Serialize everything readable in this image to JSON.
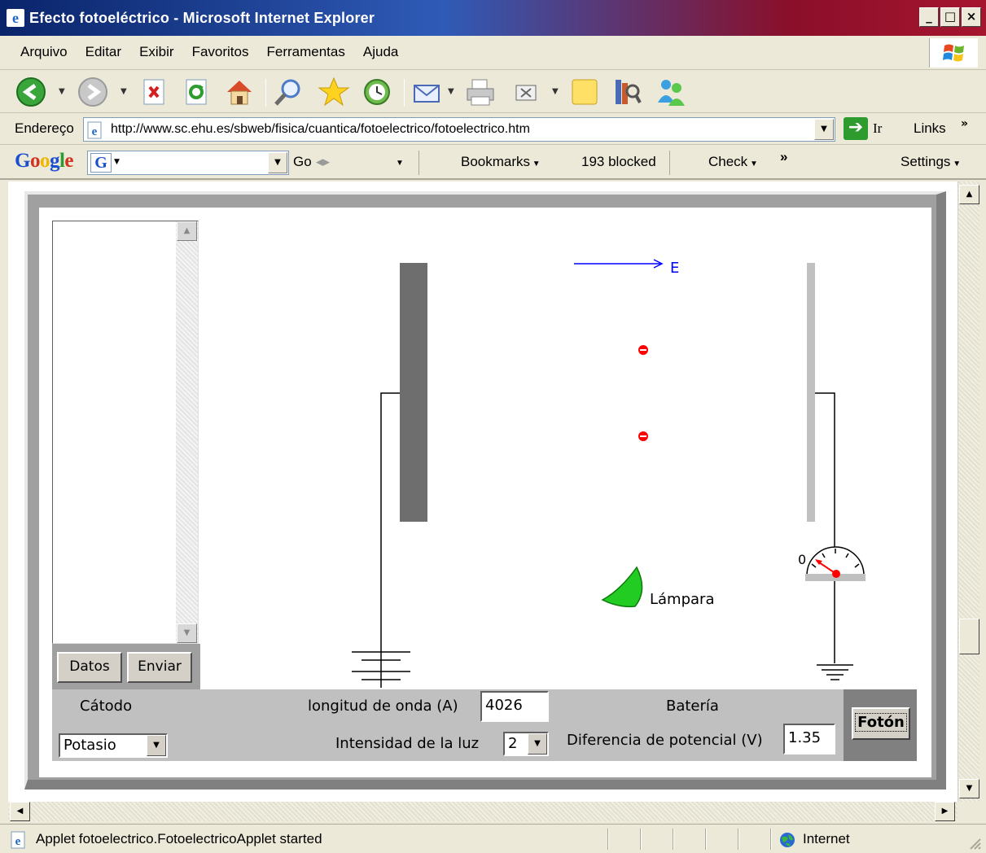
{
  "window": {
    "title": "Efecto fotoeléctrico - Microsoft Internet Explorer",
    "controls": [
      "_",
      "□",
      "×"
    ]
  },
  "menu": [
    "Arquivo",
    "Editar",
    "Exibir",
    "Favoritos",
    "Ferramentas",
    "Ajuda"
  ],
  "address": {
    "label": "Endereço",
    "url": "http://www.sc.ehu.es/sbweb/fisica/cuantica/fotoelectrico/fotoelectrico.htm",
    "go_label": "Ir",
    "links_label": "Links"
  },
  "google_bar": {
    "logo": "Google",
    "go_label": "Go",
    "bookmarks_label": "Bookmarks",
    "blocked_label": "193 blocked",
    "check_label": "Check",
    "settings_label": "Settings"
  },
  "applet": {
    "field_label": "E",
    "lamp_label": "Lámpara",
    "meter_zero": "0",
    "buttons": {
      "datos": "Datos",
      "enviar": "Enviar"
    },
    "cathode": {
      "label": "Cátodo",
      "selected": "Potasio"
    },
    "wavelength": {
      "label": "longitud de onda (A)",
      "value": "4026"
    },
    "intensity": {
      "label": "Intensidad de la luz",
      "selected": "2"
    },
    "battery": {
      "label": "Batería"
    },
    "potential": {
      "label": "Diferencia de potencial (V)",
      "value": "1.35"
    },
    "photon_button": "Fotón"
  },
  "status": {
    "text": "Applet fotoelectrico.FotoelectricoApplet started",
    "zone": "Internet"
  },
  "colors": {
    "field_arrow": "#0000ff",
    "electron": "#ff0000",
    "lamp": "#22cc22",
    "cathode_plate": "#6e6e6e",
    "anode_plate": "#c0c0c0"
  }
}
